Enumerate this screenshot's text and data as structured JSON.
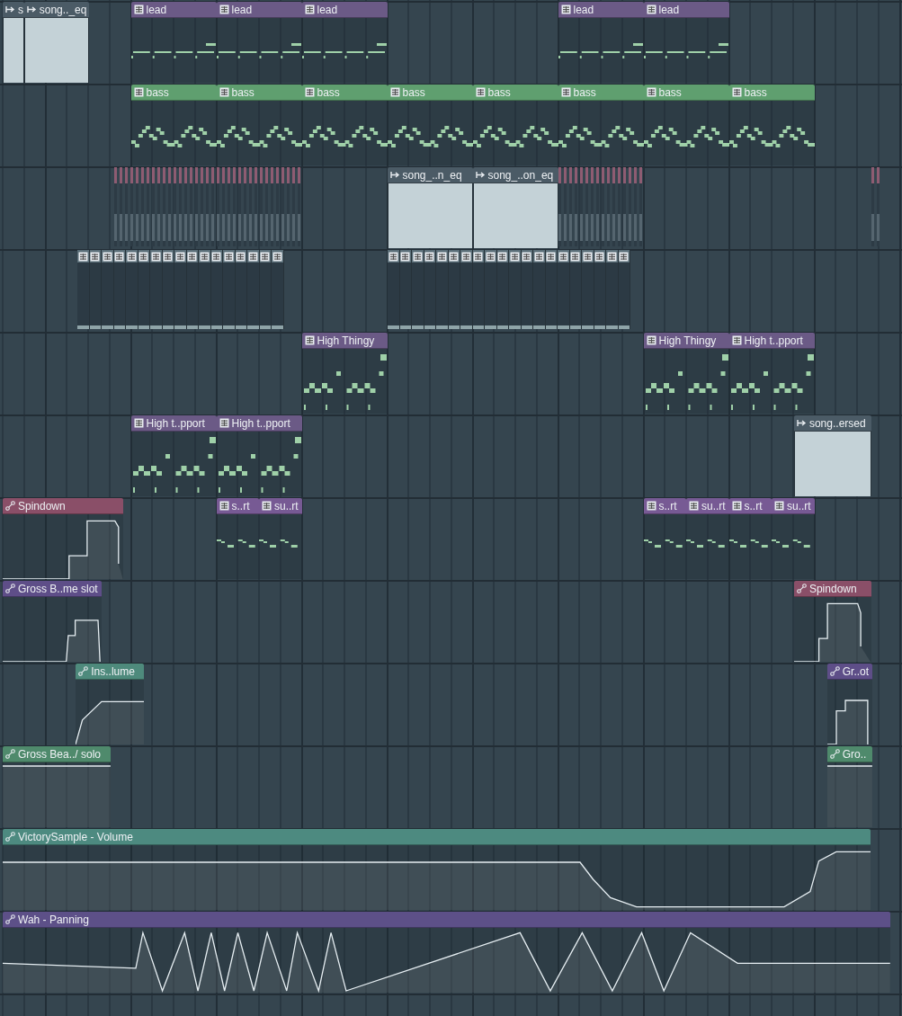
{
  "tracks": [
    {
      "clips": [
        {
          "kind": "audio",
          "label": "s",
          "color": "#4b5b66"
        },
        {
          "kind": "audio",
          "label": "song.._eq",
          "color": "#4b5b66"
        },
        {
          "kind": "pattern",
          "label": "lead",
          "color": "#6b5a86"
        },
        {
          "kind": "pattern",
          "label": "lead",
          "color": "#6b5a86"
        },
        {
          "kind": "pattern",
          "label": "lead",
          "color": "#6b5a86"
        },
        {
          "kind": "pattern",
          "label": "lead",
          "color": "#6b5a86"
        },
        {
          "kind": "pattern",
          "label": "lead",
          "color": "#6b5a86"
        }
      ]
    },
    {
      "clips": [
        {
          "kind": "pattern",
          "label": "bass",
          "color": "#5f9f6f"
        },
        {
          "kind": "pattern",
          "label": "bass",
          "color": "#5f9f6f"
        },
        {
          "kind": "pattern",
          "label": "bass",
          "color": "#5f9f6f"
        },
        {
          "kind": "pattern",
          "label": "bass",
          "color": "#5f9f6f"
        },
        {
          "kind": "pattern",
          "label": "bass",
          "color": "#5f9f6f"
        },
        {
          "kind": "pattern",
          "label": "bass",
          "color": "#5f9f6f"
        },
        {
          "kind": "pattern",
          "label": "bass",
          "color": "#5f9f6f"
        },
        {
          "kind": "pattern",
          "label": "bass",
          "color": "#5f9f6f"
        }
      ]
    },
    {
      "clips": [
        {
          "kind": "audio",
          "label": "song_..n_eq",
          "color": "#4b5b66"
        },
        {
          "kind": "audio",
          "label": "song_..on_eq",
          "color": "#4b5b66"
        }
      ]
    },
    {
      "clips": [
        {
          "kind": "strip",
          "color": "#5a6e78"
        },
        {
          "kind": "strip",
          "color": "#5a6e78"
        }
      ]
    },
    {
      "clips": [
        {
          "kind": "pattern",
          "label": "High Thingy",
          "color": "#6b5a86"
        },
        {
          "kind": "pattern",
          "label": "High Thingy",
          "color": "#6b5a86"
        },
        {
          "kind": "pattern",
          "label": "High t..pport",
          "color": "#6b5a86"
        }
      ]
    },
    {
      "clips": [
        {
          "kind": "pattern",
          "label": "High t..pport",
          "color": "#6b5a86"
        },
        {
          "kind": "pattern",
          "label": "High t..pport",
          "color": "#6b5a86"
        },
        {
          "kind": "audio",
          "label": "song..ersed",
          "color": "#4b5b66"
        }
      ]
    },
    {
      "clips": [
        {
          "kind": "automation",
          "label": "Spindown",
          "color": "#8a4f68"
        },
        {
          "kind": "pattern",
          "label": "s..rt",
          "color": "#775a94"
        },
        {
          "kind": "pattern",
          "label": "su..rt",
          "color": "#775a94"
        },
        {
          "kind": "pattern",
          "label": "s..rt",
          "color": "#775a94"
        },
        {
          "kind": "pattern",
          "label": "su..rt",
          "color": "#775a94"
        },
        {
          "kind": "pattern",
          "label": "s..rt",
          "color": "#775a94"
        },
        {
          "kind": "pattern",
          "label": "su..rt",
          "color": "#775a94"
        }
      ]
    },
    {
      "clips": [
        {
          "kind": "automation",
          "label": "Gross B..me slot",
          "color": "#5e4e88"
        },
        {
          "kind": "automation",
          "label": "Spindown",
          "color": "#8a4f68"
        }
      ]
    },
    {
      "clips": [
        {
          "kind": "automation",
          "label": "Ins..lume",
          "color": "#4e8a7c"
        },
        {
          "kind": "automation",
          "label": "Gr..ot",
          "color": "#5e4e88"
        }
      ]
    },
    {
      "clips": [
        {
          "kind": "automation",
          "label": "Gross Bea../ solo",
          "color": "#4f8a6c"
        },
        {
          "kind": "automation",
          "label": "Gro..",
          "color": "#4f8a6c"
        }
      ]
    },
    {
      "clips": [
        {
          "kind": "automation",
          "label": "VictorySample - Volume",
          "color": "#4d8a80"
        }
      ]
    },
    {
      "clips": [
        {
          "kind": "automation",
          "label": "Wah - Panning",
          "color": "#5d5088"
        }
      ]
    }
  ]
}
